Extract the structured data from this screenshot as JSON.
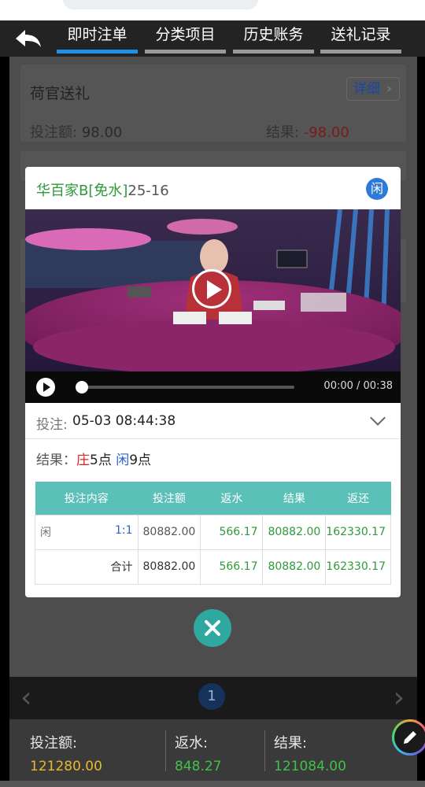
{
  "nav": {
    "tabs": [
      {
        "label": "即时注单",
        "active": true
      },
      {
        "label": "分类项目",
        "active": false
      },
      {
        "label": "历史账务",
        "active": false
      },
      {
        "label": "送礼记录",
        "active": false
      }
    ]
  },
  "card1": {
    "title": "荷官送礼",
    "detail_label": "详细",
    "bet_label": "投注额:",
    "bet_value": "98.00",
    "result_label": "结果:",
    "result_value": "-98.00"
  },
  "modal": {
    "game": "华百家B",
    "tag": "[免水]",
    "round": "25-16",
    "badge": "闲",
    "video": {
      "time_display": "00:00 / 00:38",
      "progress": 0.0
    },
    "bet_label": "投注:",
    "bet_time": "05-03 08:44:38",
    "result_label": "结果：",
    "banker_label": "庄",
    "banker_points": "5点",
    "player_label": "闲",
    "player_points": "9点",
    "table": {
      "headers": [
        "投注内容",
        "投注额",
        "返水",
        "结果",
        "返还"
      ],
      "row": {
        "content": "闲",
        "odds": "1:1",
        "amount": "80882.00",
        "rebate": "566.17",
        "result": "80882.00",
        "return": "162330.17"
      },
      "total": {
        "label": "合计",
        "amount": "80882.00",
        "rebate": "566.17",
        "result": "80882.00",
        "return": "162330.17"
      }
    }
  },
  "pager": {
    "current_page": "1"
  },
  "summary": {
    "bet_label": "投注额:",
    "bet_value": "121280.00",
    "rebate_label": "返水:",
    "rebate_value": "848.27",
    "result_label": "结果:",
    "result_value": "121084.00"
  },
  "colors": {
    "accent_blue": "#1e90e8",
    "teal": "#2fa9a0",
    "green": "#2e9a3a",
    "red": "#d22222",
    "yellow": "#e8b830"
  },
  "icons": [
    "back-arrow-icon",
    "chevron-right-icon",
    "play-icon",
    "chevron-down-icon",
    "close-icon",
    "pencil-icon"
  ]
}
